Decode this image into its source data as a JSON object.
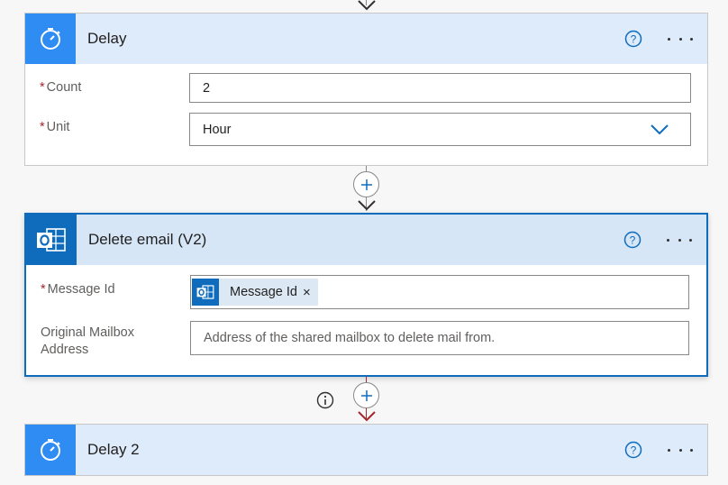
{
  "delay_card": {
    "title": "Delay",
    "icon": "stopwatch-icon",
    "fields": {
      "count_label": "Count",
      "count_value": "2",
      "unit_label": "Unit",
      "unit_value": "Hour"
    }
  },
  "delete_email_card": {
    "title": "Delete email (V2)",
    "icon": "outlook-icon",
    "fields": {
      "message_id_label": "Message Id",
      "message_id_token": "Message Id",
      "mailbox_label_line1": "Original Mailbox",
      "mailbox_label_line2": "Address",
      "mailbox_placeholder": "Address of the shared mailbox to delete mail from."
    }
  },
  "delay2_card": {
    "title": "Delay 2",
    "icon": "stopwatch-icon"
  },
  "required_marker": "*",
  "token_close": "×",
  "colors": {
    "header_bg": "#ddebfb",
    "delay_icon_bg": "#2f8cf3",
    "outlook_icon_bg": "#0f6cbd",
    "selected_border": "#0f6cbd",
    "required": "#a4262c",
    "error_arrow": "#a4262c"
  }
}
